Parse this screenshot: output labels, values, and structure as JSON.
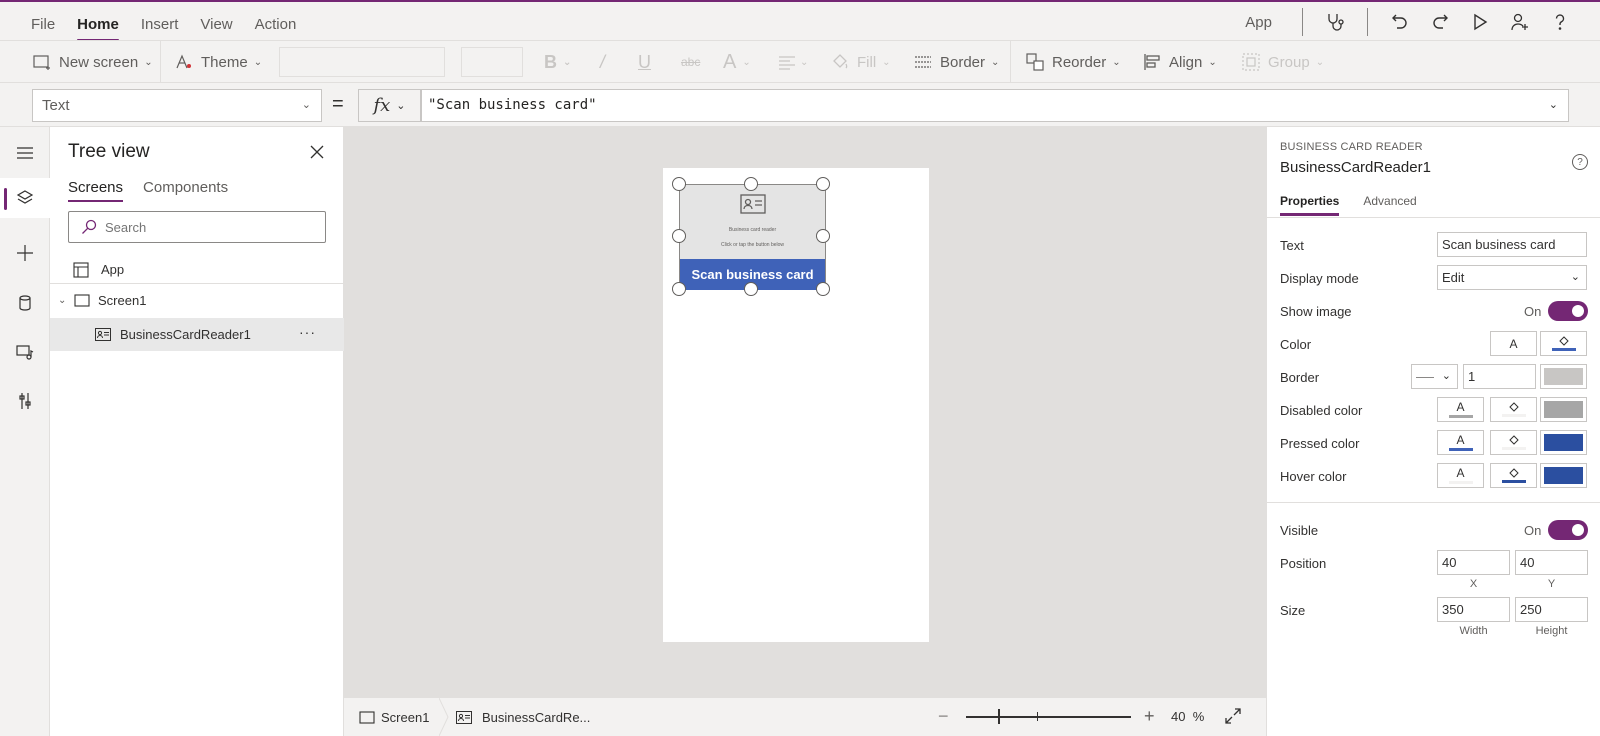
{
  "menu": [
    "File",
    "Home",
    "Insert",
    "View",
    "Action"
  ],
  "topright": {
    "app_label": "App"
  },
  "ribbon": {
    "new_screen": "New screen",
    "theme": "Theme",
    "fill": "Fill",
    "border": "Border",
    "reorder": "Reorder",
    "align": "Align",
    "group": "Group"
  },
  "formula": {
    "property": "Text",
    "equals": "=",
    "fx": "fx",
    "expression": "\"Scan business card\""
  },
  "tree": {
    "title": "Tree view",
    "tabs": [
      "Screens",
      "Components"
    ],
    "search_placeholder": "Search",
    "items": {
      "app": "App",
      "screen": "Screen1",
      "control": "BusinessCardReader1",
      "more": "···"
    }
  },
  "canvas": {
    "control_title": "Business card reader",
    "control_subtitle": "Click or tap the button below",
    "button_text": "Scan business card"
  },
  "status": {
    "screen": "Screen1",
    "control": "BusinessCardRe...",
    "zoom_value": "40",
    "zoom_unit": "%",
    "zoom_minus": "−",
    "zoom_plus": "+",
    "zoom_level": 40
  },
  "props": {
    "type": "BUSINESS CARD READER",
    "name": "BusinessCardReader1",
    "help": "?",
    "tabs": [
      "Properties",
      "Advanced"
    ],
    "labels": {
      "text": "Text",
      "display_mode": "Display mode",
      "show_image": "Show image",
      "color": "Color",
      "border": "Border",
      "disabled_color": "Disabled color",
      "pressed_color": "Pressed color",
      "hover_color": "Hover color",
      "visible": "Visible",
      "position": "Position",
      "size": "Size"
    },
    "values": {
      "text": "Scan business card",
      "display_mode": "Edit",
      "show_image": "On",
      "border_width": "1",
      "visible": "On",
      "x": "40",
      "y": "40",
      "width": "350",
      "height": "250"
    },
    "sublabels": {
      "x": "X",
      "y": "Y",
      "width": "Width",
      "height": "Height"
    },
    "glyph_a": "A"
  },
  "colors": {
    "accent": "#742774",
    "button_blue": "#3f62b8",
    "pressed_blue": "#2b4fa0",
    "disabled_gray": "#a6a6a6",
    "border_gray": "#c8c6c4"
  }
}
